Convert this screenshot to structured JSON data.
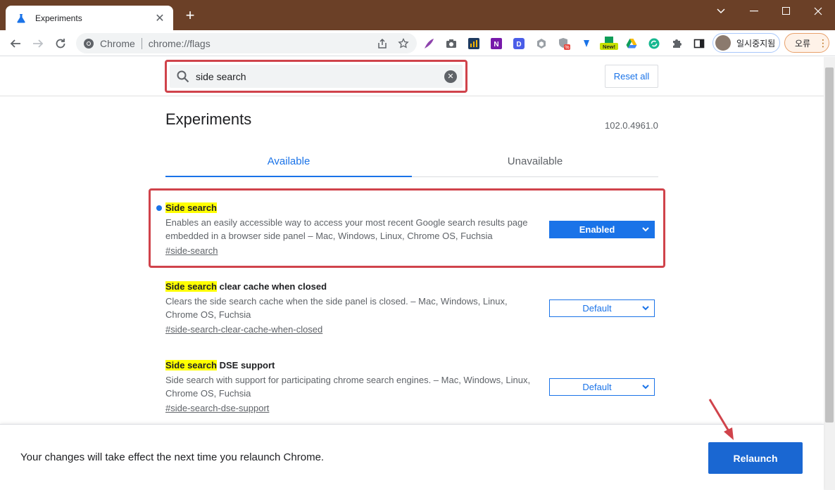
{
  "browser": {
    "tab_title": "Experiments",
    "new_tab_label": "+",
    "site_name": "Chrome",
    "url": "chrome://flags",
    "profile_name": "일시중지됨",
    "error_label": "오류",
    "new_badge": "New!",
    "onenote_letter": "N",
    "dashlane_letter": "D",
    "percent_badge": "%"
  },
  "flags_page": {
    "search_value": "side search",
    "reset_all_label": "Reset all",
    "title": "Experiments",
    "version": "102.0.4961.0",
    "tabs": [
      {
        "label": "Available",
        "active": true
      },
      {
        "label": "Unavailable",
        "active": false
      }
    ],
    "flags": [
      {
        "name_highlight": "Side search",
        "name_rest": "",
        "description": "Enables an easily accessible way to access your most recent Google search results page embedded in a browser side panel – Mac, Windows, Linux, Chrome OS, Fuchsia",
        "link": "#side-search",
        "value": "Enabled",
        "modified": true
      },
      {
        "name_highlight": "Side search",
        "name_rest": " clear cache when closed",
        "description": "Clears the side search cache when the side panel is closed. – Mac, Windows, Linux, Chrome OS, Fuchsia",
        "link": "#side-search-clear-cache-when-closed",
        "value": "Default",
        "modified": false
      },
      {
        "name_highlight": "Side search",
        "name_rest": " DSE support",
        "description": "Side search with support for participating chrome search engines. – Mac, Windows, Linux, Chrome OS, Fuchsia",
        "link": "#side-search-dse-support",
        "value": "Default",
        "modified": false
      }
    ],
    "relaunch_message": "Your changes will take effect the next time you relaunch Chrome.",
    "relaunch_label": "Relaunch"
  },
  "colors": {
    "accent": "#1a73e8",
    "highlight": "#ffff00",
    "annotation_red": "#d0434b",
    "titlebar": "#6b4027"
  }
}
